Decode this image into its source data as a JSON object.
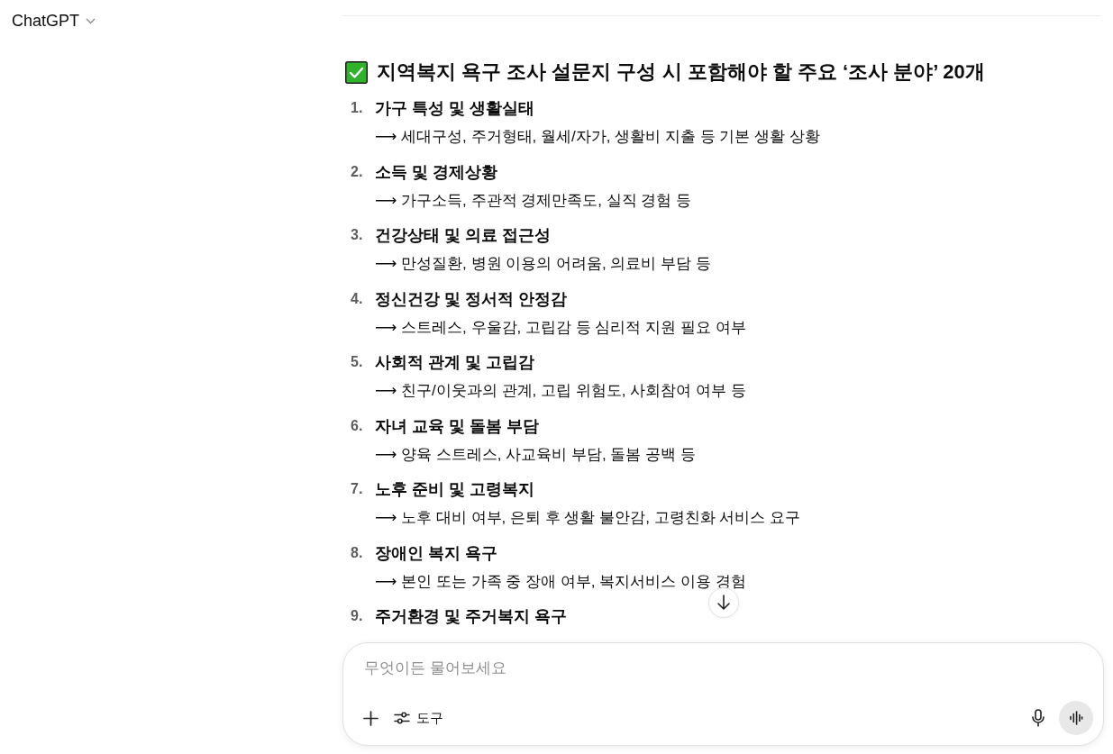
{
  "header": {
    "model_name": "ChatGPT"
  },
  "conversation": {
    "heading": "지역복지 욕구 조사 설문지 구성 시 포함해야 할 주요 ‘조사 분야’ 20개",
    "items": [
      {
        "number": "1.",
        "title": "가구 특성 및 생활실태",
        "detail": "⟶ 세대구성, 주거형태, 월세/자가, 생활비 지출 등 기본 생활 상황"
      },
      {
        "number": "2.",
        "title": "소득 및 경제상황",
        "detail": "⟶ 가구소득, 주관적 경제만족도, 실직 경험 등"
      },
      {
        "number": "3.",
        "title": "건강상태 및 의료 접근성",
        "detail": "⟶ 만성질환, 병원 이용의 어려움, 의료비 부담 등"
      },
      {
        "number": "4.",
        "title": "정신건강 및 정서적 안정감",
        "detail": "⟶ 스트레스, 우울감, 고립감 등 심리적 지원 필요 여부"
      },
      {
        "number": "5.",
        "title": "사회적 관계 및 고립감",
        "detail": "⟶ 친구/이웃과의 관계, 고립 위험도, 사회참여 여부 등"
      },
      {
        "number": "6.",
        "title": "자녀 교육 및 돌봄 부담",
        "detail": "⟶ 양육 스트레스, 사교육비 부담, 돌봄 공백 등"
      },
      {
        "number": "7.",
        "title": "노후 준비 및 고령복지",
        "detail": "⟶ 노후 대비 여부, 은퇴 후 생활 불안감, 고령친화 서비스 요구"
      },
      {
        "number": "8.",
        "title": "장애인 복지 욕구",
        "detail": "⟶ 본인 또는 가족 중 장애 여부, 복지서비스 이용 경험"
      },
      {
        "number": "9.",
        "title": "주거환경 및 주거복지 욕구"
      }
    ]
  },
  "composer": {
    "placeholder": "무엇이든 물어보세요",
    "tools_label": "도구"
  }
}
